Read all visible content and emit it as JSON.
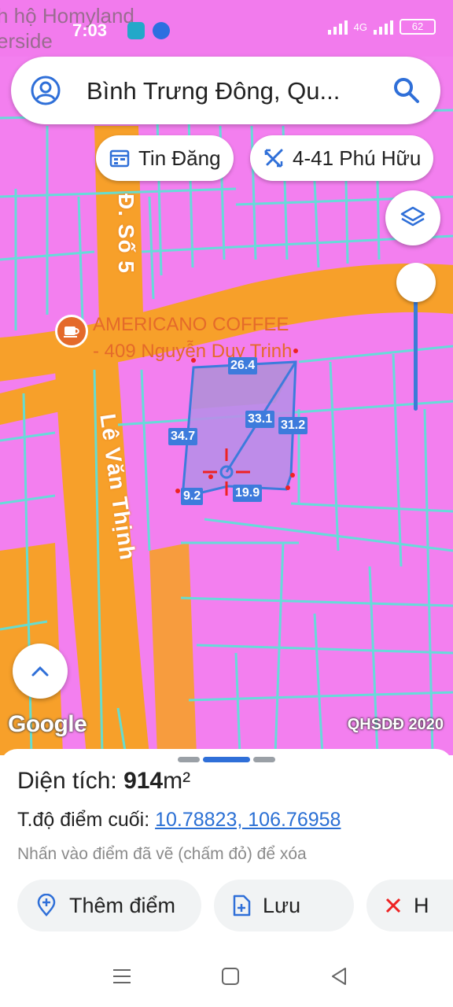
{
  "status": {
    "time": "7:03",
    "network": "4G",
    "battery": "62"
  },
  "map_bg_text": [
    "h hộ Homyland",
    "erside"
  ],
  "search": {
    "query": "Bình Trưng Đông, Qu..."
  },
  "chips": [
    {
      "label": "Tin Đăng",
      "icon": "calendar-icon"
    },
    {
      "label": "4-41 Phú Hữu",
      "icon": "ruler-cross-icon"
    }
  ],
  "poi": {
    "line1": "AMERICANO COFFEE",
    "line2": "- 409 Nguyễn Duy Trinh"
  },
  "roads": {
    "so5": "Đ. Số 5",
    "levanthinh": "Lê Văn Thịnh"
  },
  "measurements": [
    "26.4",
    "33.1",
    "31.2",
    "34.7",
    "9.2",
    "19.9"
  ],
  "attribution": {
    "google": "Google",
    "layer": "QHSDĐ 2020"
  },
  "colors": {
    "land_residential": "#f37fef",
    "road": "#f7a02a",
    "parcel_border": "#5fe0d8",
    "measure_line": "#3d7bdc",
    "plot_fill": "#b88ee8"
  },
  "sheet": {
    "area_label": "Diện tích: ",
    "area_value": "914",
    "area_unit": "m²",
    "coord_label": "T.độ điểm cuối: ",
    "coord_value": "10.78823, 106.76958",
    "hint": "Nhấn vào điểm đã vẽ (chấm đỏ) để xóa",
    "buttons": [
      {
        "label": "Thêm điểm",
        "icon": "add-point-icon"
      },
      {
        "label": "Lưu",
        "icon": "save-file-icon"
      },
      {
        "label": "H",
        "icon": "close-icon"
      }
    ]
  }
}
